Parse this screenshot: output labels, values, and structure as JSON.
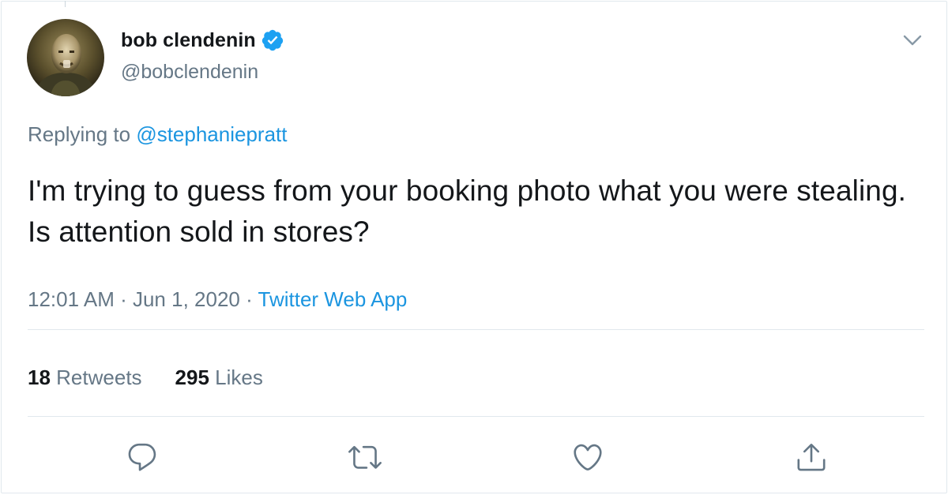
{
  "tweet": {
    "author": {
      "display_name": "bob clendenin",
      "handle": "@bobclendenin",
      "verified": true
    },
    "reply_prefix": "Replying to",
    "reply_mention": "@stephaniepratt",
    "text": "I'm trying to guess from your booking photo what you were stealing. Is attention sold in stores?",
    "time": "12:01 AM",
    "separator": " · ",
    "date": "Jun 1, 2020",
    "source": "Twitter Web App",
    "retweets_count": "18",
    "retweets_label": "Retweets",
    "likes_count": "295",
    "likes_label": "Likes"
  },
  "icons": {
    "verified": "verified-badge-icon",
    "caret": "chevron-down-icon",
    "reply": "reply-icon",
    "retweet": "retweet-icon",
    "like": "heart-icon",
    "share": "share-icon"
  },
  "colors": {
    "link_blue": "#1b95e0",
    "verified_blue": "#1da1f2",
    "secondary_text": "#657786",
    "primary_text": "#14171a",
    "divider": "#e1e8ed"
  }
}
